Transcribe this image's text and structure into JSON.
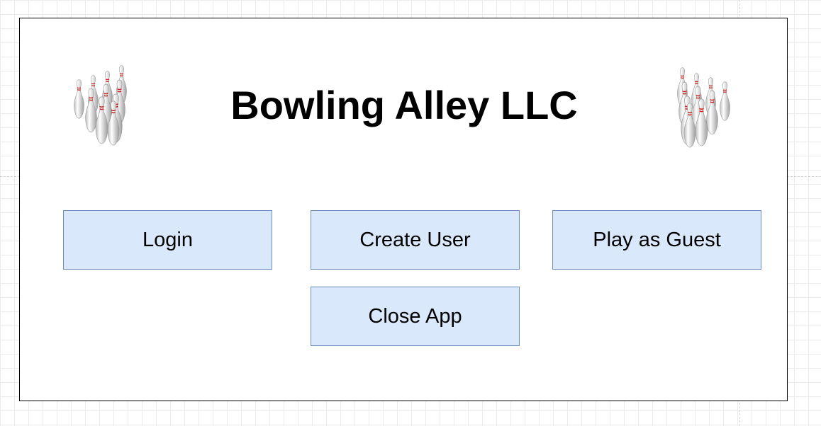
{
  "app": {
    "title": "Bowling Alley LLC"
  },
  "buttons": {
    "login": "Login",
    "create_user": "Create User",
    "play_as_guest": "Play as Guest",
    "close_app": "Close App"
  },
  "icons": {
    "left": "bowling-pins-icon",
    "right": "bowling-pins-icon"
  },
  "colors": {
    "button_fill": "#dae8fc",
    "button_border": "#6c8ebf",
    "pin_stripe": "#d11f1f"
  }
}
